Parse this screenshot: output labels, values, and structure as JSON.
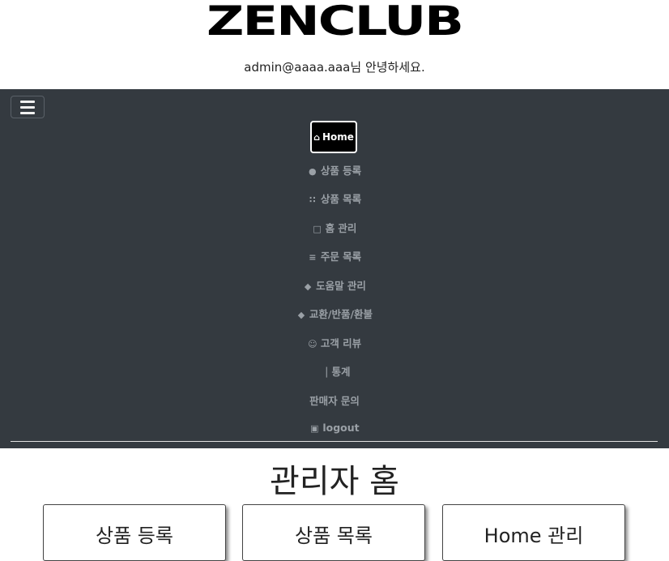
{
  "header": {
    "brand": "ZENCLUB",
    "greeting": "admin@aaaa.aaa님 안녕하세요."
  },
  "nav": {
    "toggler_icon": "hamburger-icon",
    "home": {
      "label": "Home",
      "icon": "home-icon"
    },
    "items": [
      {
        "label": "상품 등록",
        "icon": "hand-holding-icon"
      },
      {
        "label": "상품 목록",
        "icon": "grid-icon"
      },
      {
        "label": "홈 관리",
        "icon": "monitor-icon"
      },
      {
        "label": "주문 목록",
        "icon": "list-icon"
      },
      {
        "label": "도움말 관리",
        "icon": "eraser-icon"
      },
      {
        "label": "교환/반품/환불",
        "icon": "eraser-icon"
      },
      {
        "label": "고객 리뷰",
        "icon": "smile-icon"
      },
      {
        "label": "통계",
        "icon": "chart-icon"
      },
      {
        "label": "판매자 문의",
        "icon": ""
      },
      {
        "label": "logout",
        "icon": "unlock-icon"
      }
    ]
  },
  "main": {
    "title": "관리자 홈",
    "cards": [
      {
        "label": "상품 등록"
      },
      {
        "label": "상품 목록"
      },
      {
        "label": "Home 관리"
      }
    ]
  },
  "colors": {
    "navbar_bg": "#343a40",
    "nav_text": "#9aa0a6",
    "home_bg": "#000000"
  }
}
